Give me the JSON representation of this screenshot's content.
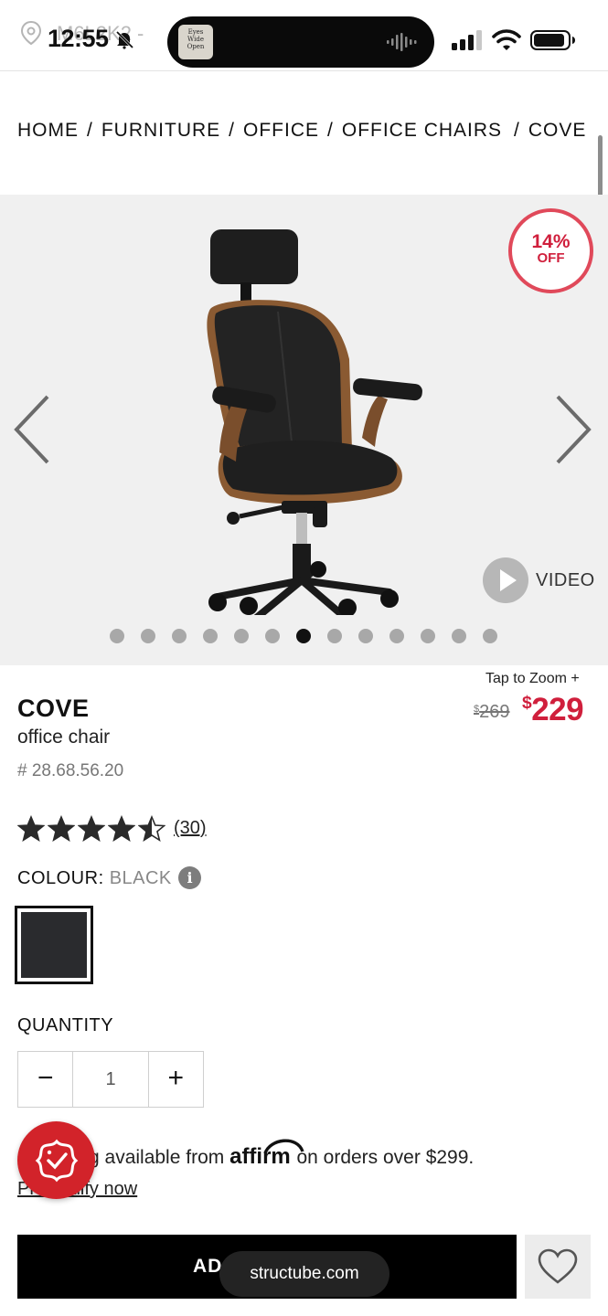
{
  "status_bar": {
    "time": "12:55",
    "location_text": "M6L2K2 -",
    "island_art_text": "Eyes Wide Open"
  },
  "breadcrumb": [
    "HOME",
    "FURNITURE",
    "OFFICE",
    "OFFICE CHAIRS",
    "COVE"
  ],
  "breadcrumb_separator": "/",
  "gallery": {
    "badge_percent": "14%",
    "badge_off": "OFF",
    "video_label": "VIDEO",
    "slide_count": 13,
    "active_slide": 7
  },
  "product": {
    "zoom_hint": "Tap to Zoom +",
    "name": "COVE",
    "subtitle": "office chair",
    "sku": "# 28.68.56.20",
    "price_old_symbol": "$",
    "price_old": "269",
    "price_new_symbol": "$",
    "price_new": "229",
    "rating": 4.5,
    "reviews": "(30)",
    "colour_label": "COLOUR:",
    "colour_value": "BLACK",
    "swatch_color": "#2a2b2e",
    "quantity_label": "QUANTITY",
    "quantity": "1",
    "qty_minus": "−",
    "qty_plus": "+"
  },
  "financing": {
    "text_before": "g available from",
    "affirm": "affirm",
    "text_after": "on orders over $299.",
    "prequalify": "Prequalify now"
  },
  "actions": {
    "add_to_cart": "AD",
    "url": "structube.com"
  },
  "colors": {
    "accent_red": "#d01f3c",
    "badge_border": "#e0495a",
    "promo_red": "#d2232a",
    "cta_black": "#000000"
  }
}
